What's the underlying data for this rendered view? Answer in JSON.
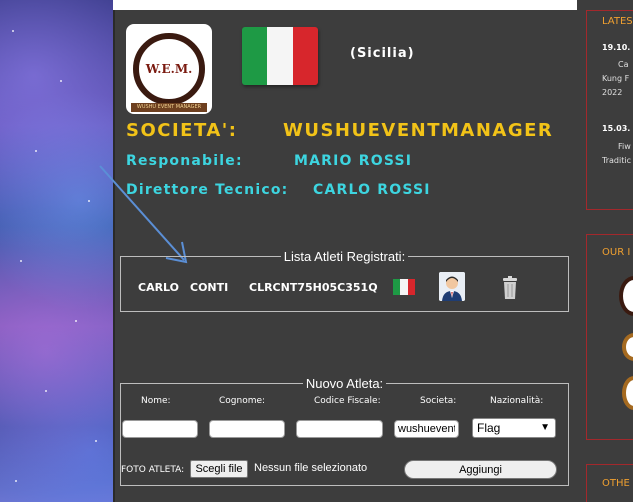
{
  "header": {
    "region": "(Sicilia)",
    "logo_text": "W.E.M.",
    "logo_subtext": "WUSHU EVENT MANAGER"
  },
  "club": {
    "societa_label": "SOCIETA':",
    "societa_value": "WUSHUEVENTMANAGER",
    "responsabile_label": "Responabile:",
    "responsabile_value": "MARIO ROSSI",
    "direttore_label": "Direttore Tecnico:",
    "direttore_value": "CARLO ROSSI"
  },
  "athletes": {
    "legend": "Lista Atleti Registrati:",
    "rows": [
      {
        "nome": "CARLO",
        "cognome": "CONTI",
        "codice_fiscale": "CLRCNT75H05C351Q"
      }
    ]
  },
  "new_athlete": {
    "legend": "Nuovo Atleta:",
    "labels": {
      "nome": "Nome:",
      "cognome": "Cognome:",
      "codice_fiscale": "Codice Fiscale:",
      "societa": "Societa:",
      "nazionalita": "Nazionalità:"
    },
    "values": {
      "nome": "",
      "cognome": "",
      "codice_fiscale": "",
      "societa": "wushuevent"
    },
    "nazionalita_selected": "Flag",
    "foto_label": "FOTO ATLETA:",
    "file_button": "Scegli file",
    "file_status": "Nessun file selezionato",
    "submit_label": "Aggiungi"
  },
  "sidebar": {
    "latest_title": "LATES",
    "news": [
      {
        "date": "19.10.",
        "lines": [
          "Ca",
          "Kung F",
          "2022"
        ]
      },
      {
        "date": "15.03.",
        "lines": [
          "Fiw",
          "Traditic"
        ]
      }
    ],
    "our_title": "OUR I",
    "other_title": "OTHE"
  },
  "colors": {
    "panel": "#3d3d3d",
    "gold": "#f2c318",
    "cyan": "#3dd5e0",
    "sidebar_accent": "#a3282c",
    "sidebar_title": "#f0a030"
  },
  "icons": [
    "italy-flag-icon",
    "avatar-icon",
    "trash-icon",
    "chevron-down-icon",
    "arrow-annotation-icon"
  ]
}
